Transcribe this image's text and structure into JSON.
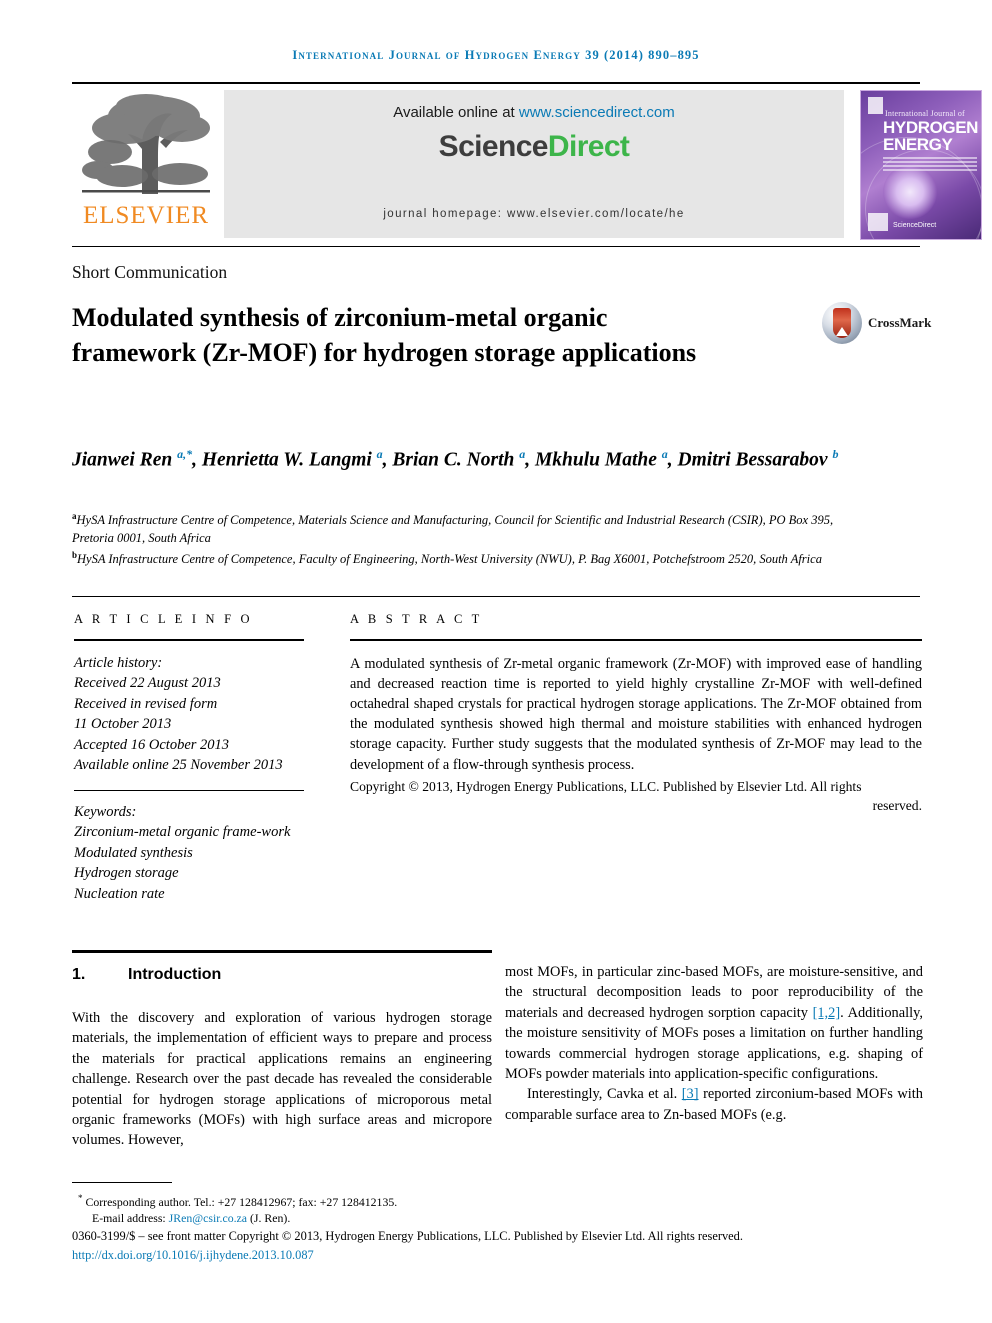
{
  "running_head": "International Journal of Hydrogen Energy 39 (2014) 890–895",
  "masthead": {
    "publisher": "ELSEVIER",
    "available_prefix": "Available online at ",
    "available_url": "www.sciencedirect.com",
    "sciencedirect_part1": "Science",
    "sciencedirect_part2": "Direct",
    "journal_homepage": "journal homepage: www.elsevier.com/locate/he",
    "cover": {
      "line_small": "International Journal of",
      "line_big_1": "HYDROGEN",
      "line_big_2": "ENERGY",
      "footer_text": "ScienceDirect"
    }
  },
  "article": {
    "type": "Short Communication",
    "title": "Modulated synthesis of zirconium-metal organic framework (Zr-MOF) for hydrogen storage applications",
    "crossmark_label": "CrossMark",
    "authors_html": "Jianwei Ren <sup>a,*</sup>, Henrietta W. Langmi <sup>a</sup>, Brian C. North <sup>a</sup>, Mkhulu Mathe <sup>a</sup>, Dmitri Bessarabov <sup>b</sup>",
    "affiliations": [
      {
        "marker": "a",
        "text": "HySA Infrastructure Centre of Competence, Materials Science and Manufacturing, Council for Scientific and Industrial Research (CSIR), PO Box 395, Pretoria 0001, South Africa"
      },
      {
        "marker": "b",
        "text": "HySA Infrastructure Centre of Competence, Faculty of Engineering, North-West University (NWU), P. Bag X6001, Potchefstroom 2520, South Africa"
      }
    ]
  },
  "article_info": {
    "heading": "A R T I C L E   I N F O",
    "history_label": "Article history:",
    "history": [
      "Received 22 August 2013",
      "Received in revised form",
      "11 October 2013",
      "Accepted 16 October 2013",
      "Available online 25 November 2013"
    ],
    "keywords_label": "Keywords:",
    "keywords": [
      "Zirconium-metal organic frame-work",
      "Modulated synthesis",
      "Hydrogen storage",
      "Nucleation rate"
    ]
  },
  "abstract": {
    "heading": "A B S T R A C T",
    "body": "A modulated synthesis of Zr-metal organic framework (Zr-MOF) with improved ease of handling and decreased reaction time is reported to yield highly crystalline Zr-MOF with well-defined octahedral shaped crystals for practical hydrogen storage applications. The Zr-MOF obtained from the modulated synthesis showed high thermal and moisture stabilities with enhanced hydrogen storage capacity. Further study suggests that the modulated synthesis of Zr-MOF may lead to the development of a flow-through synthesis process.",
    "copyright": "Copyright © 2013, Hydrogen Energy Publications, LLC. Published by Elsevier Ltd. All rights",
    "copyright_last": "reserved."
  },
  "introduction": {
    "number": "1.",
    "heading": "Introduction",
    "left_paragraph": "With the discovery and exploration of various hydrogen storage materials, the implementation of efficient ways to prepare and process the materials for practical applications remains an engineering challenge. Research over the past decade has revealed the considerable potential for hydrogen storage applications of microporous metal organic frameworks (MOFs) with high surface areas and micropore volumes. However,",
    "right_paragraph_1a": "most MOFs, in particular zinc-based MOFs, are moisture-sensitive, and the structural decomposition leads to poor reproducibility of the materials and decreased hydrogen sorption capacity ",
    "right_cite_1": "[1,2]",
    "right_paragraph_1b": ". Additionally, the moisture sensitivity of MOFs poses a limitation on further handling towards commercial hydrogen storage applications, e.g. shaping of MOFs powder materials into application-specific configurations.",
    "right_paragraph_2a": "Interestingly, Cavka et al. ",
    "right_cite_2": "[3]",
    "right_paragraph_2b": " reported zirconium-based MOFs with comparable surface area to Zn-based MOFs (e.g."
  },
  "footer": {
    "corresponding_marker": "*",
    "corresponding_label": " Corresponding author. Tel.: +27 128412967; fax: +27 128412135.",
    "email_label": "E-mail address: ",
    "email": "JRen@csir.co.za",
    "email_suffix": " (J. Ren).",
    "issn_line": "0360-3199/$ – see front matter Copyright © 2013, Hydrogen Energy Publications, LLC. Published by Elsevier Ltd. All rights reserved.",
    "doi": "http://dx.doi.org/10.1016/j.ijhydene.2013.10.087"
  },
  "colors": {
    "link_blue": "#0a7ab5",
    "sciencedirect_green": "#3db54a",
    "elsevier_orange": "#f08a22"
  }
}
